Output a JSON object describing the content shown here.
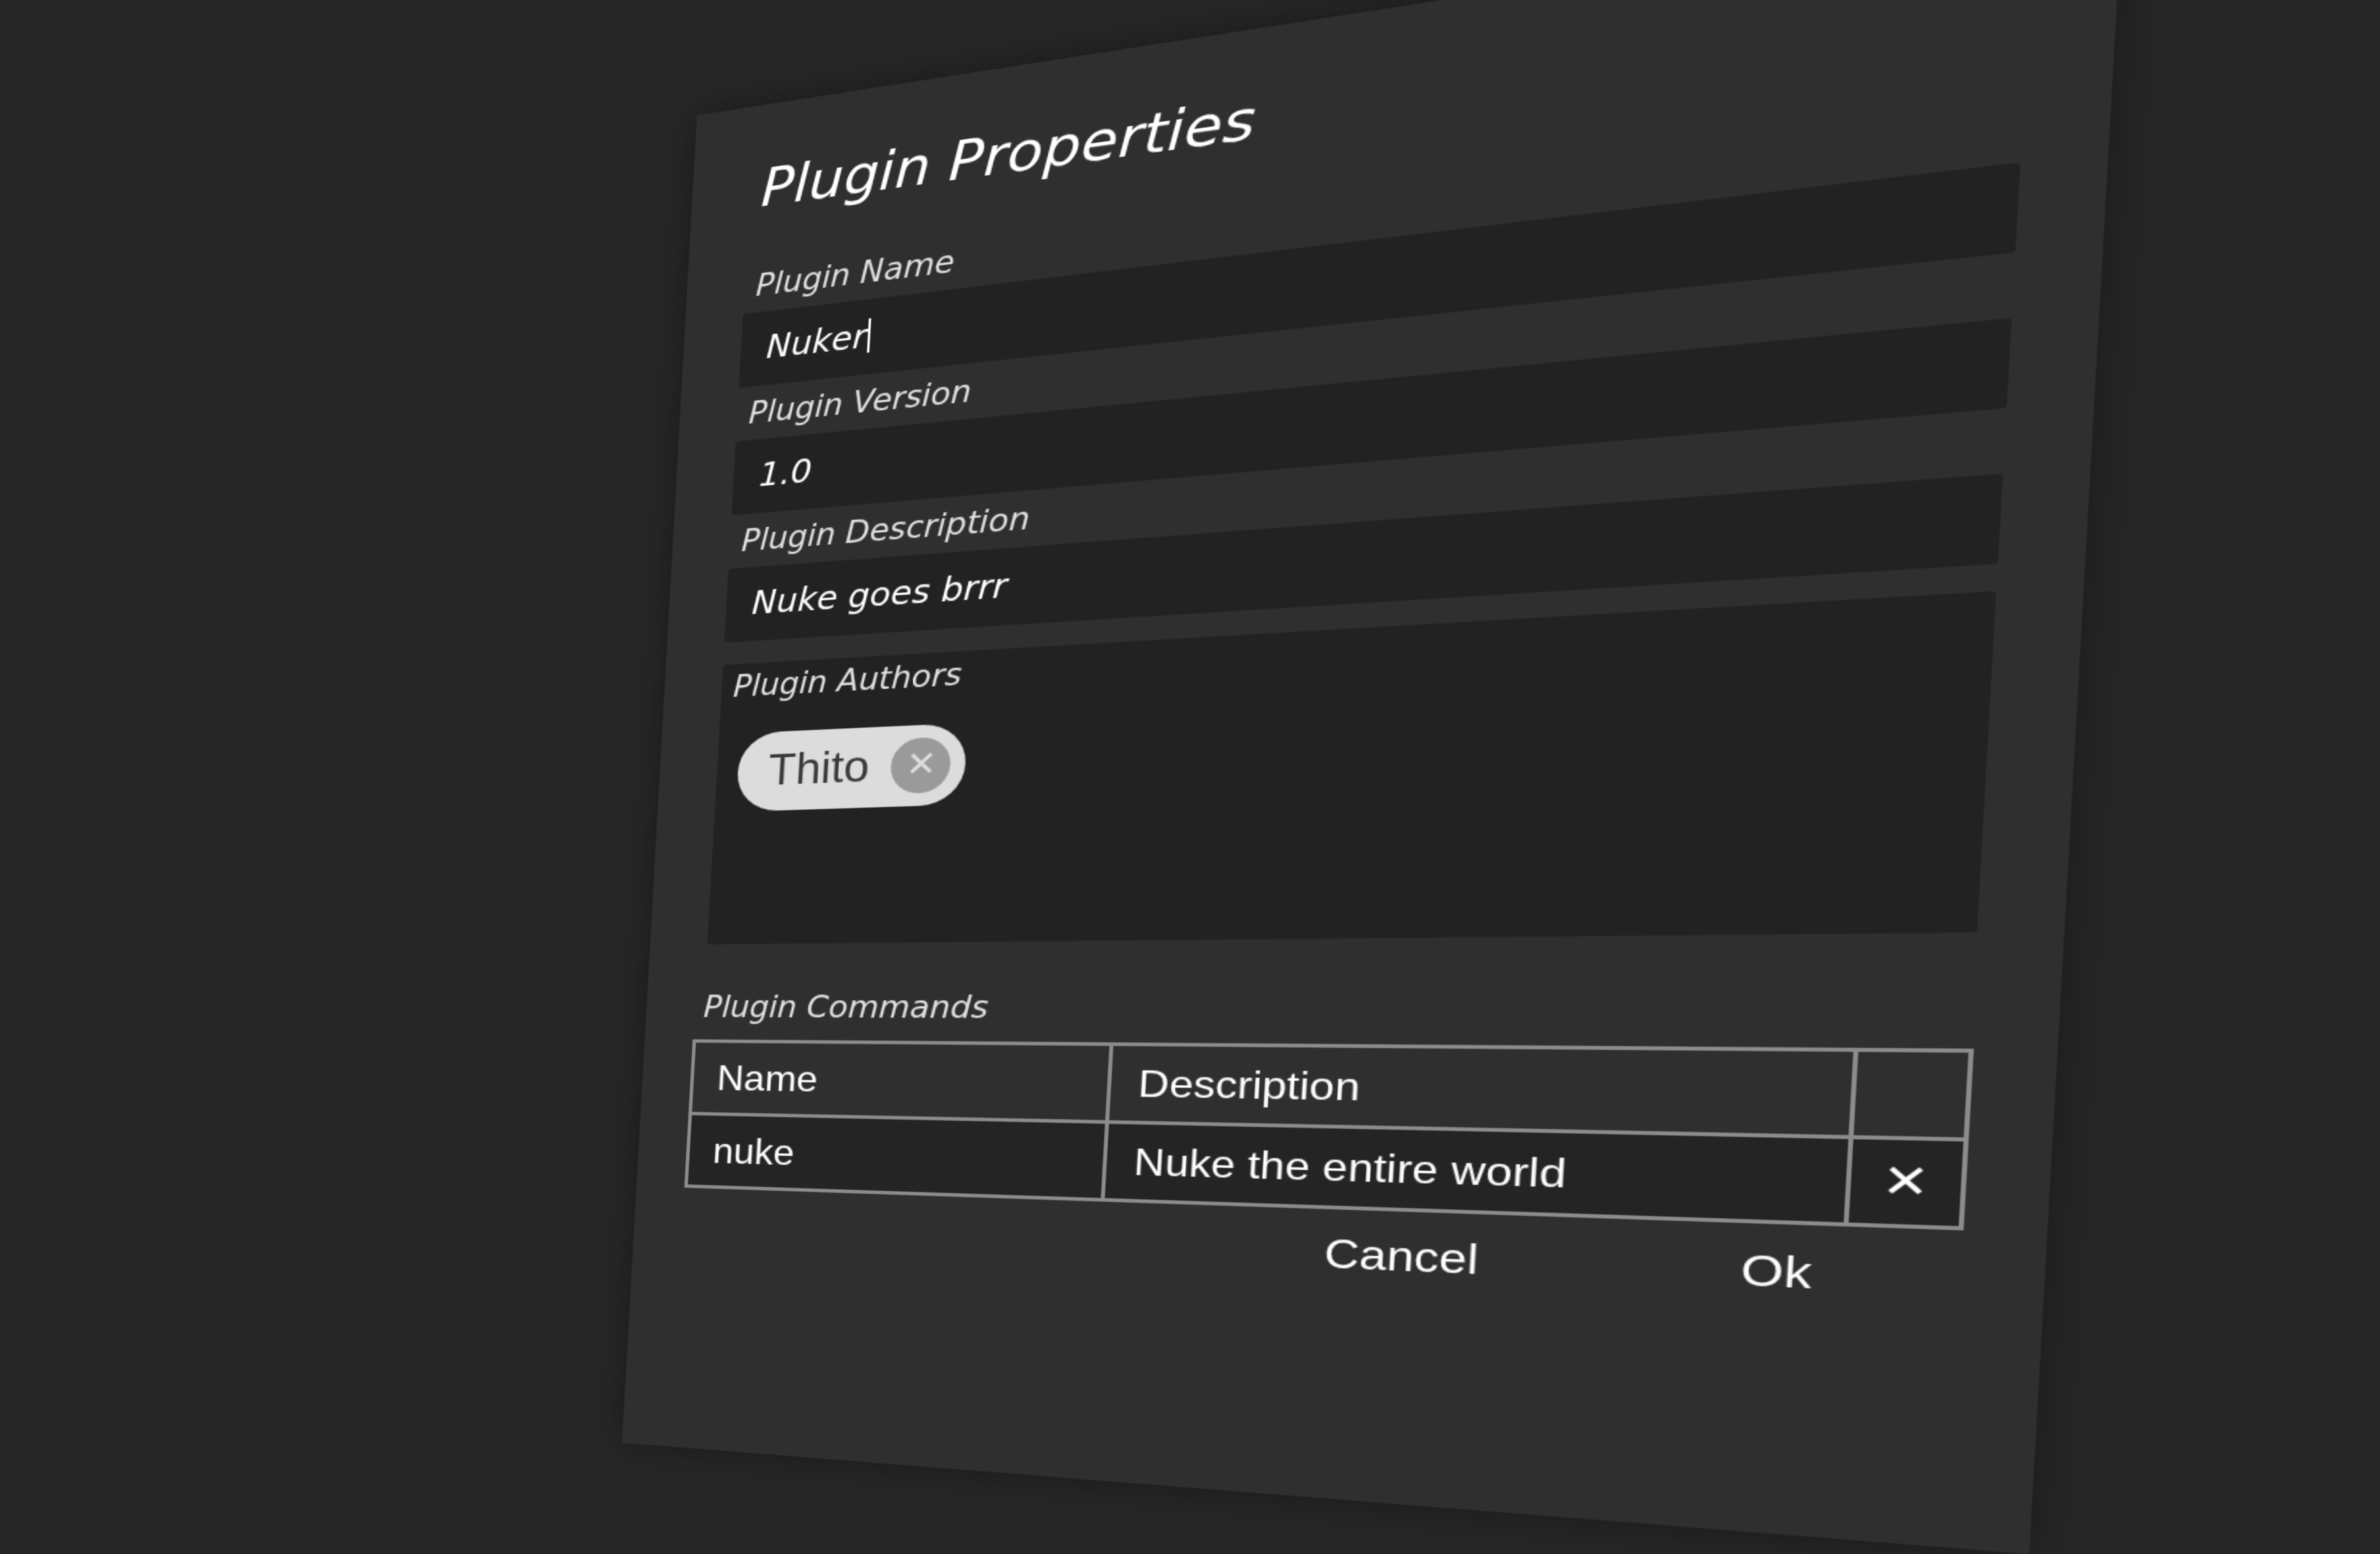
{
  "dialog": {
    "title": "Plugin Properties",
    "fields": {
      "name": {
        "label": "Plugin Name",
        "value": "Nuker"
      },
      "version": {
        "label": "Plugin Version",
        "value": "1.0"
      },
      "description": {
        "label": "Plugin Description",
        "value": "Nuke goes brrr"
      }
    },
    "authors": {
      "label": "Plugin Authors",
      "chips": [
        {
          "name": "Thito",
          "remove_icon": "close-circle-icon"
        }
      ]
    },
    "commands": {
      "label": "Plugin Commands",
      "columns": [
        "Name",
        "Description",
        ""
      ],
      "rows": [
        {
          "name": "nuke",
          "description": "Nuke the entire world",
          "delete_icon": "close-icon"
        }
      ]
    },
    "buttons": {
      "cancel": "Cancel",
      "ok": "Ok"
    }
  },
  "colors": {
    "background": "#262626",
    "panel": "#2f2f2f",
    "field": "#222222",
    "chip": "#dcdcdc",
    "table_border": "#8c8c8c"
  }
}
